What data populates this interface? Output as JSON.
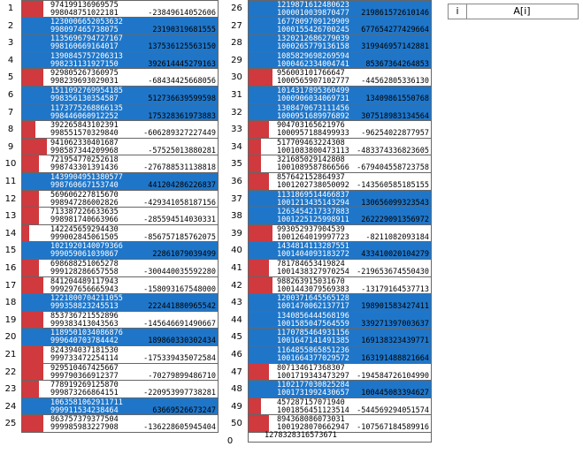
{
  "header": {
    "index_label": "i",
    "value_label": "A[i]"
  },
  "left": [
    {
      "i": "1",
      "a": "974199136969575",
      "b": "998048751022181",
      "c": "-23849614052606",
      "kind": "red",
      "fill": 0.04
    },
    {
      "i": "2",
      "a": "1230006652053632",
      "b": "998097465738075",
      "c": "23190319681555",
      "kind": "blue",
      "fill": 1.0
    },
    {
      "i": "3",
      "a": "1135696794727167",
      "b": "998160669164017",
      "c": "137536125563150",
      "kind": "blue",
      "fill": 1.0
    },
    {
      "i": "4",
      "a": "1390845757206313",
      "b": "998231131927150",
      "c": "392614445279163",
      "kind": "blue",
      "fill": 1.0
    },
    {
      "i": "5",
      "a": "929805267360975",
      "b": "998239693029031",
      "c": "-68434425668056",
      "kind": "red",
      "fill": 0.04
    },
    {
      "i": "6",
      "a": "1511092769954185",
      "b": "998356130354587",
      "c": "512736639599598",
      "kind": "blue",
      "fill": 1.0
    },
    {
      "i": "7",
      "a": "1173775268866135",
      "b": "998446060912252",
      "c": "175328361973883",
      "kind": "blue",
      "fill": 1.0
    },
    {
      "i": "8",
      "a": "392265843102391",
      "b": "998551570329840",
      "c": "-606289327227449",
      "kind": "red",
      "fill": 0.02
    },
    {
      "i": "9",
      "a": "941062330401687",
      "b": "998587344209968",
      "c": "-57525013880281",
      "kind": "red",
      "fill": 0.05
    },
    {
      "i": "10",
      "a": "721954770252618",
      "b": "998743301391436",
      "c": "-276788531138818",
      "kind": "red",
      "fill": 0.03
    },
    {
      "i": "11",
      "a": "1439904951380577",
      "b": "998760667153740",
      "c": "441204286226837",
      "kind": "blue",
      "fill": 1.0
    },
    {
      "i": "12",
      "a": "569606227815670",
      "b": "998947286002826",
      "c": "-429341058187156",
      "kind": "red",
      "fill": 0.03
    },
    {
      "i": "13",
      "a": "713387226633635",
      "b": "998981740663966",
      "c": "-285594514030331",
      "kind": "red",
      "fill": 0.03
    },
    {
      "i": "14",
      "a": "142245659294430",
      "b": "999002845061505",
      "c": "-856757185762075",
      "kind": "red",
      "fill": 0.0
    },
    {
      "i": "15",
      "a": "1021920140079366",
      "b": "999059061039867",
      "c": "22861079039499",
      "kind": "blue",
      "fill": 1.0
    },
    {
      "i": "16",
      "a": "698688251065278",
      "b": "999128286657558",
      "c": "-300440035592280",
      "kind": "red",
      "fill": 0.03
    },
    {
      "i": "17",
      "a": "841204489117943",
      "b": "999297656665943",
      "c": "-158093167548000",
      "kind": "red",
      "fill": 0.04
    },
    {
      "i": "18",
      "a": "1221800704211055",
      "b": "999358823245513",
      "c": "222441880965542",
      "kind": "blue",
      "fill": 1.0
    },
    {
      "i": "19",
      "a": "853736721552896",
      "b": "999383413043563",
      "c": "-145646691490667",
      "kind": "red",
      "fill": 0.04
    },
    {
      "i": "20",
      "a": "1189501034086876",
      "b": "999640703784442",
      "c": "189860330302434",
      "kind": "blue",
      "fill": 1.0
    },
    {
      "i": "21",
      "a": "824394037181530",
      "b": "999733472254114",
      "c": "-175339435072584",
      "kind": "red",
      "fill": 0.04
    },
    {
      "i": "22",
      "a": "929510467425667",
      "b": "999790366912377",
      "c": "-70279899486710",
      "kind": "red",
      "fill": 0.04
    },
    {
      "i": "23",
      "a": "778919269125870",
      "b": "999873266864151",
      "c": "-220953997738281",
      "kind": "red",
      "fill": 0.03
    },
    {
      "i": "24",
      "a": "1063581062911711",
      "b": "999911534238464",
      "c": "63669526673247",
      "kind": "blue",
      "fill": 1.0
    },
    {
      "i": "25",
      "a": "863757379377504",
      "b": "999985983227908",
      "c": "-136228605945404",
      "kind": "red",
      "fill": 0.04
    }
  ],
  "right": [
    {
      "i": "26",
      "a": "1219871612480623",
      "b": "1000010039870477",
      "c": "219861572610146",
      "kind": "blue",
      "fill": 1.0
    },
    {
      "i": "27",
      "a": "1677809709129909",
      "b": "1000155426700245",
      "c": "677654277429664",
      "kind": "blue",
      "fill": 1.0
    },
    {
      "i": "28",
      "a": "1320212686279039",
      "b": "1000265779136158",
      "c": "319946957142881",
      "kind": "blue",
      "fill": 1.0
    },
    {
      "i": "29",
      "a": "1085829698269594",
      "b": "1000462334004741",
      "c": "85367364264853",
      "kind": "blue",
      "fill": 1.0
    },
    {
      "i": "30",
      "a": "956003101766647",
      "b": "1000565907102777",
      "c": "-44562805336130",
      "kind": "red",
      "fill": 0.05
    },
    {
      "i": "31",
      "a": "1014317895360499",
      "b": "1000906034069731",
      "c": "13409861550768",
      "kind": "blue",
      "fill": 1.0
    },
    {
      "i": "32",
      "a": "1308470673111456",
      "b": "1000951689976892",
      "c": "307518983134564",
      "kind": "blue",
      "fill": 1.0
    },
    {
      "i": "33",
      "a": "904703165621976",
      "b": "1000957188499933",
      "c": "-96254022877957",
      "kind": "red",
      "fill": 0.04
    },
    {
      "i": "34",
      "a": "517709463224308",
      "b": "1001083800473113",
      "c": "-483374336823605",
      "kind": "red",
      "fill": 0.02
    },
    {
      "i": "35",
      "a": "321685029142808",
      "b": "1001089587866566",
      "c": "-679404558723758",
      "kind": "red",
      "fill": 0.02
    },
    {
      "i": "36",
      "a": "857642152864937",
      "b": "1001202738050092",
      "c": "-143560585185155",
      "kind": "red",
      "fill": 0.04
    },
    {
      "i": "37",
      "a": "1131869514466837",
      "b": "1001213435143294",
      "c": "130656099323543",
      "kind": "blue",
      "fill": 1.0
    },
    {
      "i": "38",
      "a": "1263454217337883",
      "b": "1001225125998911",
      "c": "262229091356972",
      "kind": "blue",
      "fill": 1.0
    },
    {
      "i": "39",
      "a": "993052937904539",
      "b": "1001264019997723",
      "c": "-8211082093184",
      "kind": "red",
      "fill": 0.05
    },
    {
      "i": "40",
      "a": "1434814113287551",
      "b": "1001404093183272",
      "c": "433410020104279",
      "kind": "blue",
      "fill": 1.0
    },
    {
      "i": "41",
      "a": "781784653419824",
      "b": "1001438327970254",
      "c": "-219653674550430",
      "kind": "red",
      "fill": 0.04
    },
    {
      "i": "42",
      "a": "988263915031670",
      "b": "1001443079569383",
      "c": "-13179164537713",
      "kind": "red",
      "fill": 0.05
    },
    {
      "i": "43",
      "a": "1200371645565128",
      "b": "1001470062137717",
      "c": "198901583427411",
      "kind": "blue",
      "fill": 1.0
    },
    {
      "i": "44",
      "a": "1340856444568196",
      "b": "1001585047564559",
      "c": "339271397003637",
      "kind": "blue",
      "fill": 1.0
    },
    {
      "i": "45",
      "a": "1170785464931156",
      "b": "1001647141491385",
      "c": "169138323439771",
      "kind": "blue",
      "fill": 1.0
    },
    {
      "i": "46",
      "a": "1164855865851236",
      "b": "1001664377029572",
      "c": "163191488821664",
      "kind": "blue",
      "fill": 1.0
    },
    {
      "i": "47",
      "a": "807134617368307",
      "b": "1001719343473297",
      "c": "-194584726104990",
      "kind": "red",
      "fill": 0.04
    },
    {
      "i": "48",
      "a": "1102177030825284",
      "b": "1001731992430657",
      "c": "100445083394627",
      "kind": "blue",
      "fill": 1.0
    },
    {
      "i": "49",
      "a": "457287157071940",
      "b": "1001856451123514",
      "c": "-544569294051574",
      "kind": "red",
      "fill": 0.02
    },
    {
      "i": "50",
      "a": "894368086073031",
      "b": "1001928070662947",
      "c": "-107567184589916",
      "kind": "red",
      "fill": 0.04
    }
  ],
  "tail": {
    "i": "0",
    "value": "1278328316573671"
  }
}
